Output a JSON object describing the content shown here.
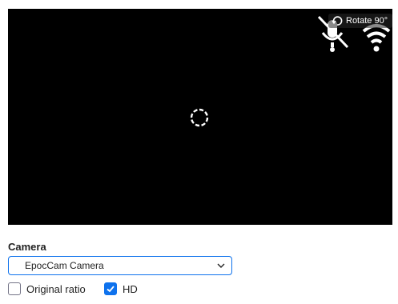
{
  "preview": {
    "rotate_label": "Rotate 90°",
    "status_icons": [
      "no-mic-icon",
      "wifi-icon"
    ],
    "loading_icon": "spinner-icon"
  },
  "camera": {
    "section_label": "Camera",
    "selected": "EpocCam Camera"
  },
  "options": {
    "original_ratio": {
      "label": "Original ratio",
      "checked": false
    },
    "hd": {
      "label": "HD",
      "checked": true
    }
  },
  "colors": {
    "accent": "#0e72ed",
    "preview_bg": "#000000"
  }
}
